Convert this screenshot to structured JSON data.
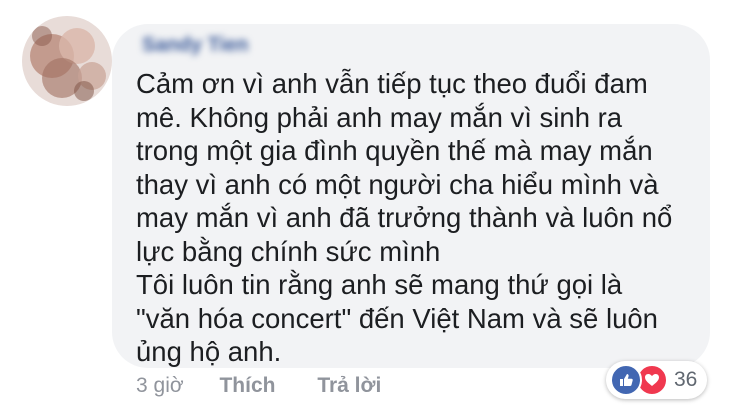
{
  "comment": {
    "author": "Sandy Tien",
    "text_lines": [
      "Cảm ơn vì anh vẫn tiếp tục theo đuổi đam",
      "mê. Không phải anh may mắn vì sinh ra",
      "trong một gia đình quyền thế mà may mắn",
      "thay vì anh có một người cha hiểu mình và",
      "may mắn vì anh đã trưởng thành và luôn nổ",
      "lực bằng chính sức mình",
      "Tôi luôn tin rằng anh sẽ mang thứ gọi là",
      "\"văn hóa concert\" đến Việt Nam và sẽ luôn",
      "ủng hộ anh."
    ]
  },
  "actions": {
    "time": "3 giờ",
    "like_label": "Thích",
    "reply_label": "Trả lời"
  },
  "reactions": {
    "icons": [
      "like-icon",
      "love-icon"
    ],
    "count": "36",
    "colors": {
      "like": "#4267b2",
      "love": "#f0384f"
    }
  },
  "colors": {
    "bubble_bg": "#f2f3f5",
    "text": "#1c1e21",
    "meta": "#90949c",
    "author": "#385898"
  }
}
